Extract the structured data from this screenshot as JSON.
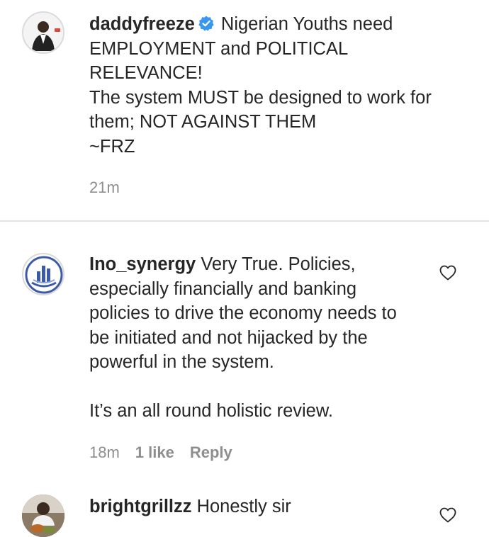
{
  "caption": {
    "username": "daddyfreeze",
    "verified": true,
    "text_lines": [
      "Nigerian Youths need",
      "EMPLOYMENT and POLITICAL",
      "RELEVANCE!",
      "The system MUST be designed to work for",
      "them; NOT AGAINST THEM",
      "~FRZ"
    ],
    "time": "21m"
  },
  "comments": [
    {
      "username": "Ino_synergy",
      "text_lines": [
        "Very True. Policies,",
        "especially financially and banking",
        "policies to drive the economy needs to",
        "be initiated and not hijacked by the",
        "powerful in the system.",
        "",
        "It’s an all round holistic review."
      ],
      "time": "18m",
      "likes": "1 like",
      "reply_label": "Reply"
    },
    {
      "username": "brightgrillzz",
      "text_lines": [
        "Honestly sir"
      ]
    }
  ],
  "colors": {
    "text": "#262626",
    "secondary": "#8e8e8e",
    "verified_badge": "#3897f0",
    "divider": "#e4e4e4"
  },
  "icons": {
    "verified": "verified-badge-icon",
    "like": "heart-outline-icon"
  }
}
